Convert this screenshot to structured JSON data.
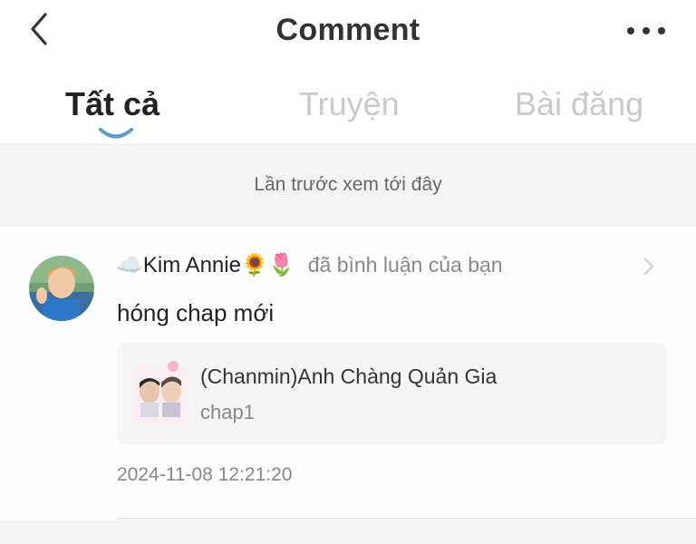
{
  "header": {
    "title": "Comment",
    "back_icon": "chevron-left-icon",
    "more_icon": "more-horizontal-icon"
  },
  "tabs": [
    {
      "label": "Tất cả",
      "active": true
    },
    {
      "label": "Truyện",
      "active": false
    },
    {
      "label": "Bài đăng",
      "active": false
    }
  ],
  "divider": {
    "text": "Lần trước xem tới đây"
  },
  "notification": {
    "user": {
      "name": "☁️Kim Annie🌻🌷",
      "action": "đã bình luận của bạn"
    },
    "comment": "hóng chap mới",
    "story": {
      "title": "(Chanmin)Anh Chàng Quản Gia",
      "chapter": "chap1"
    },
    "timestamp": "2024-11-08 12:21:20"
  },
  "colors": {
    "accent_indicator": "#5b9bd5",
    "inactive_tab": "#c9c9c9",
    "band_bg": "#f3f3f3",
    "card_bg": "#f5f5f5"
  }
}
